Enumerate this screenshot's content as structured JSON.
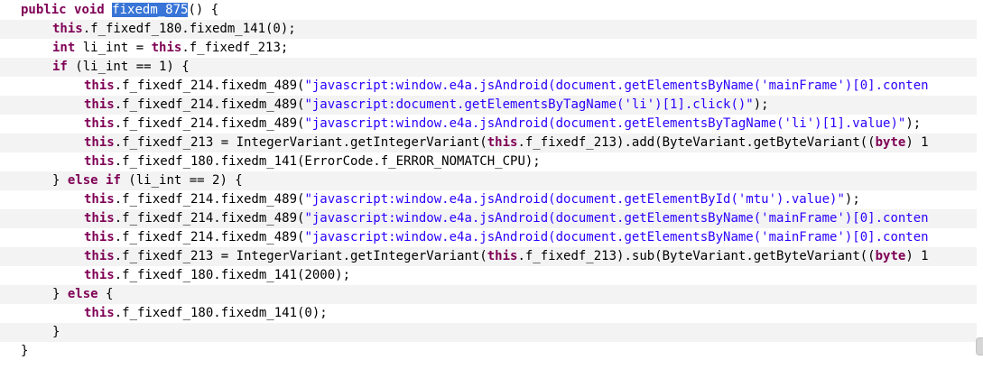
{
  "editor": {
    "lines": [
      [
        {
          "t": "public",
          "c": "kw"
        },
        {
          "t": " "
        },
        {
          "t": "void",
          "c": "kw"
        },
        {
          "t": " "
        },
        {
          "t": "fixedm_875",
          "c": "sel"
        },
        {
          "t": "() {"
        }
      ],
      [
        {
          "t": "this",
          "c": "kw"
        },
        {
          "t": ".f_fixedf_180.fixedm_141(0);"
        }
      ],
      [
        {
          "t": "int",
          "c": "kw"
        },
        {
          "t": " li_int = "
        },
        {
          "t": "this",
          "c": "kw"
        },
        {
          "t": ".f_fixedf_213;"
        }
      ],
      [
        {
          "t": "if",
          "c": "kw"
        },
        {
          "t": " (li_int == 1) {"
        }
      ],
      [
        {
          "t": "this",
          "c": "kw"
        },
        {
          "t": ".f_fixedf_214.fixedm_489("
        },
        {
          "t": "\"javascript:window.e4a.jsAndroid(document.getElementsByName('mainFrame')[0].conten",
          "c": "str"
        }
      ],
      [
        {
          "t": "this",
          "c": "kw"
        },
        {
          "t": ".f_fixedf_214.fixedm_489("
        },
        {
          "t": "\"javascript:document.getElementsByTagName('li')[1].click()\"",
          "c": "str"
        },
        {
          "t": ");"
        }
      ],
      [
        {
          "t": "this",
          "c": "kw"
        },
        {
          "t": ".f_fixedf_214.fixedm_489("
        },
        {
          "t": "\"javascript:window.e4a.jsAndroid(document.getElementsByTagName('li')[1].value)\"",
          "c": "str"
        },
        {
          "t": ");"
        }
      ],
      [
        {
          "t": "this",
          "c": "kw"
        },
        {
          "t": ".f_fixedf_213 = IntegerVariant.getIntegerVariant("
        },
        {
          "t": "this",
          "c": "kw"
        },
        {
          "t": ".f_fixedf_213).add(ByteVariant.getByteVariant(("
        },
        {
          "t": "byte",
          "c": "kw"
        },
        {
          "t": ") 1"
        }
      ],
      [
        {
          "t": "this",
          "c": "kw"
        },
        {
          "t": ".f_fixedf_180.fixedm_141(ErrorCode.f_ERROR_NOMATCH_CPU);"
        }
      ],
      [
        {
          "t": "} "
        },
        {
          "t": "else",
          "c": "kw"
        },
        {
          "t": " "
        },
        {
          "t": "if",
          "c": "kw"
        },
        {
          "t": " (li_int == 2) {"
        }
      ],
      [
        {
          "t": "this",
          "c": "kw"
        },
        {
          "t": ".f_fixedf_214.fixedm_489("
        },
        {
          "t": "\"javascript:window.e4a.jsAndroid(document.getElementById('mtu').value)\"",
          "c": "str"
        },
        {
          "t": ");"
        }
      ],
      [
        {
          "t": "this",
          "c": "kw"
        },
        {
          "t": ".f_fixedf_214.fixedm_489("
        },
        {
          "t": "\"javascript:window.e4a.jsAndroid(document.getElementsByName('mainFrame')[0].conten",
          "c": "str"
        }
      ],
      [
        {
          "t": "this",
          "c": "kw"
        },
        {
          "t": ".f_fixedf_214.fixedm_489("
        },
        {
          "t": "\"javascript:window.e4a.jsAndroid(document.getElementsByName('mainFrame')[0].conten",
          "c": "str"
        }
      ],
      [
        {
          "t": "this",
          "c": "kw"
        },
        {
          "t": ".f_fixedf_213 = IntegerVariant.getIntegerVariant("
        },
        {
          "t": "this",
          "c": "kw"
        },
        {
          "t": ".f_fixedf_213).sub(ByteVariant.getByteVariant(("
        },
        {
          "t": "byte",
          "c": "kw"
        },
        {
          "t": ") 1"
        }
      ],
      [
        {
          "t": "this",
          "c": "kw"
        },
        {
          "t": ".f_fixedf_180.fixedm_141(2000);"
        }
      ],
      [
        {
          "t": "} "
        },
        {
          "t": "else",
          "c": "kw"
        },
        {
          "t": " {"
        }
      ],
      [
        {
          "t": "this",
          "c": "kw"
        },
        {
          "t": ".f_fixedf_180.fixedm_141(0);"
        }
      ],
      [
        {
          "t": "}"
        }
      ],
      [
        {
          "t": "}"
        }
      ]
    ],
    "selection": "fixedm_875"
  },
  "colors": {
    "keyword": "#7f0055",
    "string": "#2a00ff",
    "selection": "#3875d7",
    "stripe": "#f3f3f3"
  },
  "icons": {
    "scrollbar": "scrollbar-thumb"
  }
}
